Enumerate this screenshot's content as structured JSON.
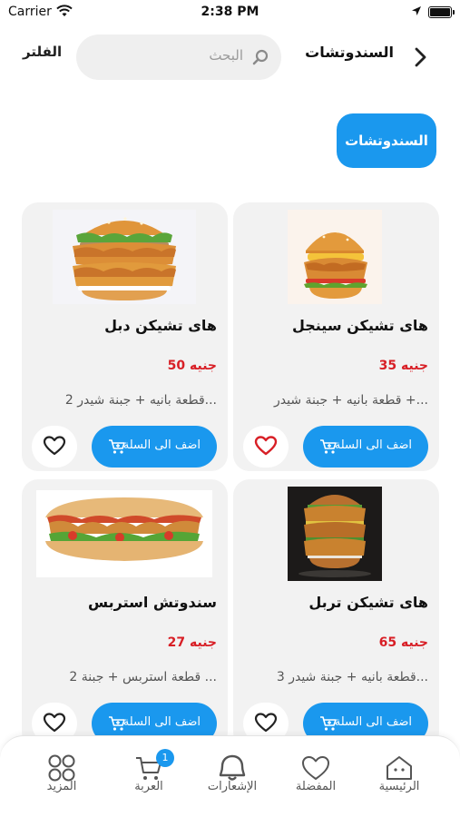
{
  "status_bar": {
    "carrier": "Carrier",
    "time": "2:38 PM",
    "battery_level": 0.9
  },
  "header": {
    "back_icon": "chevron-right-icon",
    "title": "السندوتشات",
    "search_placeholder": "البحث",
    "filter_label": "الفلتر"
  },
  "category": {
    "active_label": "السندوتشات"
  },
  "colors": {
    "accent": "#1a98ee",
    "price": "#d81f26",
    "card_bg": "#f2f2f2",
    "heart_active": "#d81f26"
  },
  "products": [
    {
      "name": "هاى تشيكن سينجل",
      "price": "35 جنيه",
      "description": "قطعة بانيه + جبنة شيدر +...",
      "add_label": "اضف الى السلة",
      "favorite": true,
      "image": "single-chicken-burger"
    },
    {
      "name": "هاى تشيكن دبل",
      "price": "50 جنيه",
      "description": "2 قطعة بانيه + جبنة شيدر...",
      "add_label": "اضف الى السلة",
      "favorite": false,
      "image": "double-chicken-burger"
    },
    {
      "name": "هاى تشيكن تربل",
      "price": "65 جنيه",
      "description": "3 قطعة بانيه + جبنة شيدر...",
      "add_label": "اضف الى السلة",
      "favorite": false,
      "image": "triple-chicken-burger"
    },
    {
      "name": "سندوتش استربس",
      "price": "27 جنيه",
      "description": "2 قطعة استربس + جبنة ...",
      "add_label": "اضف الى السلة",
      "favorite": false,
      "image": "strips-sub-sandwich"
    }
  ],
  "tabs": [
    {
      "label": "الرئيسية",
      "icon": "home-icon"
    },
    {
      "label": "المفضلة",
      "icon": "heart-icon"
    },
    {
      "label": "الإشعارات",
      "icon": "bell-icon"
    },
    {
      "label": "العربة",
      "icon": "cart-icon",
      "badge": "1"
    },
    {
      "label": "المزيد",
      "icon": "grid-icon"
    }
  ]
}
